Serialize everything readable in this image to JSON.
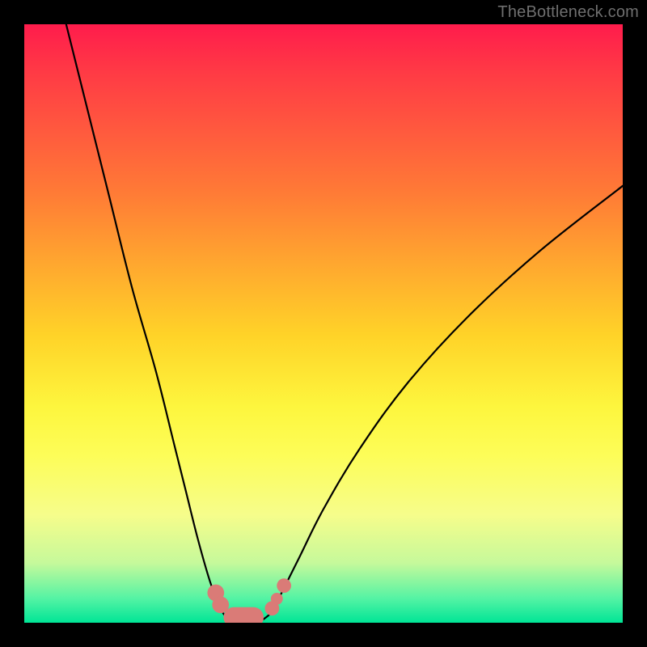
{
  "watermark": "TheBottleneck.com",
  "chart_data": {
    "type": "line",
    "title": "",
    "xlabel": "",
    "ylabel": "",
    "x_range": [
      0,
      100
    ],
    "y_range": [
      0,
      100
    ],
    "grid": false,
    "legend": null,
    "series": [
      {
        "name": "left-curve",
        "x": [
          7,
          10,
          14,
          18,
          22,
          25,
          27,
          29,
          31,
          32.5,
          33.3,
          34
        ],
        "y": [
          100,
          88,
          72,
          56,
          42,
          30,
          22,
          14,
          7,
          3,
          1.5,
          0.6
        ]
      },
      {
        "name": "right-curve",
        "x": [
          40,
          41.5,
          43,
          46,
          50,
          56,
          64,
          74,
          86,
          100
        ],
        "y": [
          0.6,
          2,
          5,
          11,
          19,
          29,
          40,
          51,
          62,
          73
        ]
      }
    ],
    "floor_segment": {
      "name": "valley-floor",
      "x": [
        34,
        40
      ],
      "y": [
        0.6,
        0.6
      ]
    },
    "markers": [
      {
        "name": "left-marker-1",
        "x": 32.0,
        "y": 5.0,
        "r": 1.4
      },
      {
        "name": "left-marker-2",
        "x": 32.8,
        "y": 3.0,
        "r": 1.4
      },
      {
        "name": "right-marker-1",
        "x": 41.4,
        "y": 2.4,
        "r": 1.2
      },
      {
        "name": "right-marker-2",
        "x": 42.2,
        "y": 4.0,
        "r": 1.0
      },
      {
        "name": "right-marker-3",
        "x": 43.4,
        "y": 6.2,
        "r": 1.2
      }
    ],
    "valley_capsule": {
      "x0": 33.3,
      "x1": 40.0,
      "y": 0.9,
      "thickness": 3.4
    },
    "background_gradient": [
      {
        "stop": 0.0,
        "color": "#ff1c4c"
      },
      {
        "stop": 0.18,
        "color": "#ff5a3e"
      },
      {
        "stop": 0.4,
        "color": "#ffa72f"
      },
      {
        "stop": 0.64,
        "color": "#fdf63e"
      },
      {
        "stop": 0.82,
        "color": "#f6fd8b"
      },
      {
        "stop": 0.96,
        "color": "#53f3a4"
      },
      {
        "stop": 1.0,
        "color": "#00e596"
      }
    ]
  }
}
